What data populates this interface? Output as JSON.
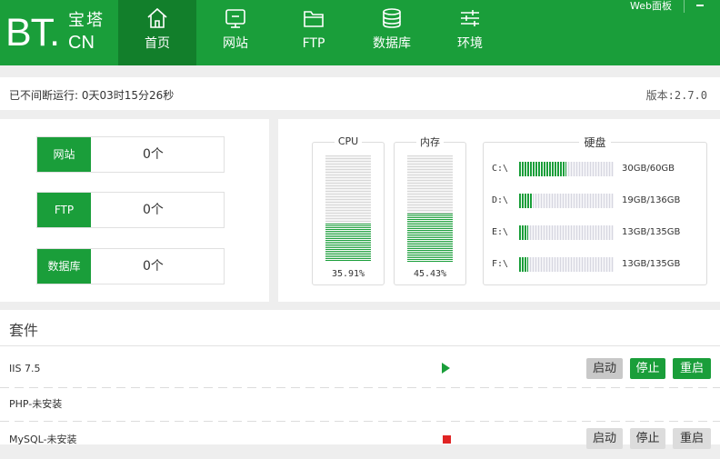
{
  "header": {
    "logo_bt": "BT.",
    "logo_zh": "宝塔",
    "logo_cn": "CN",
    "panel_link": "Web面板"
  },
  "nav": [
    {
      "label": "首页",
      "icon": "home-icon",
      "active": true
    },
    {
      "label": "网站",
      "icon": "monitor-icon",
      "active": false
    },
    {
      "label": "FTP",
      "icon": "folder-icon",
      "active": false
    },
    {
      "label": "数据库",
      "icon": "database-icon",
      "active": false
    },
    {
      "label": "环境",
      "icon": "sliders-icon",
      "active": false
    }
  ],
  "status": {
    "uptime": "已不间断运行: 0天03时15分26秒",
    "version": "版本:2.7.0"
  },
  "stats": [
    {
      "label": "网站",
      "value": "0个"
    },
    {
      "label": "FTP",
      "value": "0个"
    },
    {
      "label": "数据库",
      "value": "0个"
    }
  ],
  "resources": {
    "cpu": {
      "title": "CPU",
      "percent_text": "35.91%",
      "percent": 35.91
    },
    "memory": {
      "title": "内存",
      "percent_text": "45.43%",
      "percent": 45.43
    },
    "disk_title": "硬盘",
    "disks": [
      {
        "letter": "C:\\",
        "usage": "30GB/60GB",
        "fraction": 0.5
      },
      {
        "letter": "D:\\",
        "usage": "19GB/136GB",
        "fraction": 0.14
      },
      {
        "letter": "E:\\",
        "usage": "13GB/135GB",
        "fraction": 0.1
      },
      {
        "letter": "F:\\",
        "usage": "13GB/135GB",
        "fraction": 0.1
      }
    ]
  },
  "suite": {
    "title": "套件",
    "items": [
      {
        "name": "IIS 7.5",
        "state": "running",
        "buttons": [
          "启动",
          "停止",
          "重启"
        ]
      },
      {
        "name": "PHP-未安装",
        "state": "none",
        "buttons": []
      },
      {
        "name": "MySQL-未安装",
        "state": "stopped",
        "buttons": [
          "启动",
          "停止",
          "重启"
        ]
      }
    ]
  },
  "colors": {
    "brand": "#1a9e3a",
    "brand_dark": "#127f2b",
    "stop": "#e02424"
  }
}
